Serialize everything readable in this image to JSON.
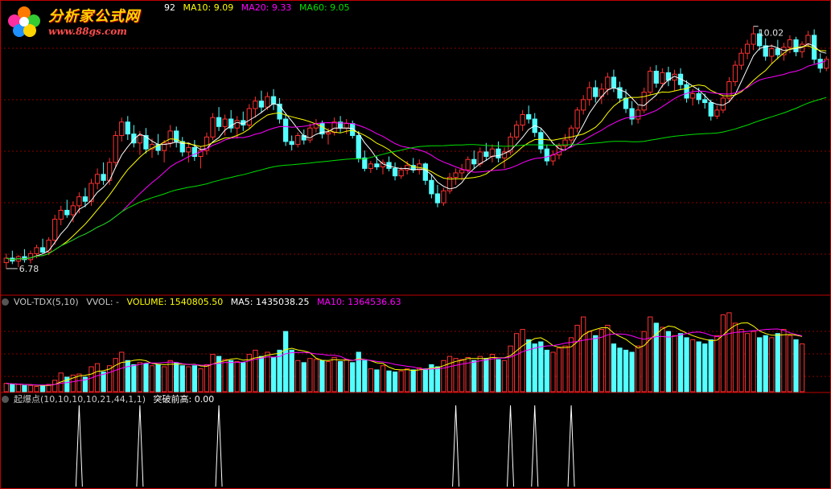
{
  "main": {
    "ma_prefix": "92",
    "ma10_label": "MA10: 9.09",
    "ma20_label": "MA20: 9.33",
    "ma60_label": "MA60: 9.05",
    "high_label": "10.02",
    "low_label": "6.78"
  },
  "volume": {
    "indicator": "VOL-TDX(5,10)",
    "vvol": "VVOL: -",
    "volume_label": "VOLUME: 1540805.50",
    "ma5_label": "MA5: 1435038.25",
    "ma10_label": "MA10: 1364536.63"
  },
  "signal": {
    "indicator": "起爆点(10,10,10,10,21,44,1,1)",
    "breakout_label": "突破前高: 0.00"
  },
  "logo": {
    "title": "分析家公式网",
    "url": "www.88gs.com"
  },
  "colors": {
    "up": "#ff3232",
    "down": "#54ffff",
    "ma5": "#ffffff",
    "ma10": "#ffff00",
    "ma20": "#ff00ff",
    "ma60": "#00e000",
    "grid": "#8b0000",
    "divider": "#c00000"
  },
  "chart_data": {
    "type": "candlestick",
    "price_range": [
      6.5,
      10.2
    ],
    "high": 10.02,
    "low": 6.78,
    "ohlc": [
      [
        6.86,
        6.98,
        6.78,
        6.92
      ],
      [
        6.92,
        7.02,
        6.84,
        6.88
      ],
      [
        6.88,
        6.96,
        6.8,
        6.94
      ],
      [
        6.94,
        7.04,
        6.86,
        6.9
      ],
      [
        6.9,
        7.02,
        6.85,
        6.98
      ],
      [
        6.98,
        7.1,
        6.92,
        7.06
      ],
      [
        7.06,
        7.18,
        6.98,
        7.0
      ],
      [
        7.0,
        7.2,
        6.96,
        7.16
      ],
      [
        7.16,
        7.5,
        7.1,
        7.44
      ],
      [
        7.44,
        7.62,
        7.36,
        7.56
      ],
      [
        7.56,
        7.7,
        7.46,
        7.5
      ],
      [
        7.5,
        7.68,
        7.4,
        7.62
      ],
      [
        7.62,
        7.8,
        7.52,
        7.74
      ],
      [
        7.74,
        7.86,
        7.6,
        7.68
      ],
      [
        7.68,
        7.98,
        7.62,
        7.92
      ],
      [
        7.92,
        8.12,
        7.84,
        8.04
      ],
      [
        8.04,
        8.2,
        7.9,
        7.96
      ],
      [
        7.96,
        8.26,
        7.9,
        8.2
      ],
      [
        8.2,
        8.62,
        8.14,
        8.56
      ],
      [
        8.56,
        8.8,
        8.48,
        8.74
      ],
      [
        8.74,
        8.82,
        8.5,
        8.58
      ],
      [
        8.58,
        8.7,
        8.4,
        8.46
      ],
      [
        8.46,
        8.62,
        8.3,
        8.56
      ],
      [
        8.56,
        8.66,
        8.32,
        8.38
      ],
      [
        8.38,
        8.52,
        8.26,
        8.44
      ],
      [
        8.44,
        8.58,
        8.3,
        8.36
      ],
      [
        8.36,
        8.5,
        8.2,
        8.46
      ],
      [
        8.46,
        8.7,
        8.4,
        8.62
      ],
      [
        8.62,
        8.68,
        8.4,
        8.48
      ],
      [
        8.48,
        8.54,
        8.28,
        8.34
      ],
      [
        8.34,
        8.46,
        8.2,
        8.4
      ],
      [
        8.4,
        8.5,
        8.22,
        8.28
      ],
      [
        8.28,
        8.42,
        8.12,
        8.36
      ],
      [
        8.36,
        8.6,
        8.3,
        8.54
      ],
      [
        8.54,
        8.86,
        8.5,
        8.8
      ],
      [
        8.8,
        8.94,
        8.62,
        8.68
      ],
      [
        8.68,
        8.84,
        8.56,
        8.78
      ],
      [
        8.78,
        8.9,
        8.6,
        8.66
      ],
      [
        8.66,
        8.82,
        8.52,
        8.76
      ],
      [
        8.76,
        8.88,
        8.62,
        8.7
      ],
      [
        8.7,
        8.98,
        8.66,
        8.92
      ],
      [
        8.92,
        9.08,
        8.8,
        9.02
      ],
      [
        9.02,
        9.16,
        8.86,
        8.94
      ],
      [
        8.94,
        9.14,
        8.9,
        9.08
      ],
      [
        9.08,
        9.18,
        8.9,
        8.98
      ],
      [
        8.98,
        9.06,
        8.72,
        8.78
      ],
      [
        8.78,
        8.86,
        8.42,
        8.48
      ],
      [
        8.48,
        8.56,
        8.36,
        8.44
      ],
      [
        8.44,
        8.6,
        8.4,
        8.56
      ],
      [
        8.56,
        8.64,
        8.44,
        8.5
      ],
      [
        8.5,
        8.72,
        8.46,
        8.66
      ],
      [
        8.66,
        8.78,
        8.6,
        8.72
      ],
      [
        8.72,
        8.76,
        8.52,
        8.58
      ],
      [
        8.58,
        8.66,
        8.44,
        8.6
      ],
      [
        8.6,
        8.8,
        8.56,
        8.74
      ],
      [
        8.74,
        8.82,
        8.6,
        8.66
      ],
      [
        8.66,
        8.78,
        8.58,
        8.72
      ],
      [
        8.72,
        8.76,
        8.52,
        8.56
      ],
      [
        8.56,
        8.62,
        8.2,
        8.26
      ],
      [
        8.26,
        8.36,
        8.08,
        8.12
      ],
      [
        8.12,
        8.22,
        8.06,
        8.18
      ],
      [
        8.18,
        8.28,
        8.1,
        8.14
      ],
      [
        8.14,
        8.24,
        8.04,
        8.2
      ],
      [
        8.2,
        8.28,
        8.08,
        8.12
      ],
      [
        8.12,
        8.2,
        7.96,
        8.02
      ],
      [
        8.02,
        8.14,
        7.98,
        8.1
      ],
      [
        8.1,
        8.22,
        8.04,
        8.16
      ],
      [
        8.16,
        8.26,
        8.06,
        8.1
      ],
      [
        8.1,
        8.24,
        8.04,
        8.18
      ],
      [
        8.18,
        8.2,
        7.9,
        7.96
      ],
      [
        7.96,
        8.04,
        7.72,
        7.78
      ],
      [
        7.78,
        7.9,
        7.6,
        7.66
      ],
      [
        7.66,
        7.86,
        7.62,
        7.82
      ],
      [
        7.82,
        8.06,
        7.78,
        8.0
      ],
      [
        8.0,
        8.12,
        7.9,
        8.06
      ],
      [
        8.06,
        8.18,
        7.96,
        8.1
      ],
      [
        8.1,
        8.28,
        8.06,
        8.24
      ],
      [
        8.24,
        8.36,
        8.12,
        8.18
      ],
      [
        8.18,
        8.4,
        8.14,
        8.34
      ],
      [
        8.34,
        8.46,
        8.22,
        8.28
      ],
      [
        8.28,
        8.44,
        8.2,
        8.38
      ],
      [
        8.38,
        8.48,
        8.2,
        8.26
      ],
      [
        8.26,
        8.4,
        8.12,
        8.34
      ],
      [
        8.34,
        8.6,
        8.3,
        8.54
      ],
      [
        8.54,
        8.76,
        8.5,
        8.7
      ],
      [
        8.7,
        8.9,
        8.62,
        8.84
      ],
      [
        8.84,
        8.96,
        8.72,
        8.78
      ],
      [
        8.78,
        8.86,
        8.54,
        8.6
      ],
      [
        8.6,
        8.66,
        8.32,
        8.38
      ],
      [
        8.38,
        8.44,
        8.16,
        8.22
      ],
      [
        8.22,
        8.36,
        8.16,
        8.3
      ],
      [
        8.3,
        8.46,
        8.24,
        8.42
      ],
      [
        8.42,
        8.58,
        8.36,
        8.5
      ],
      [
        8.5,
        8.7,
        8.44,
        8.66
      ],
      [
        8.66,
        8.94,
        8.6,
        8.9
      ],
      [
        8.9,
        9.1,
        8.84,
        9.04
      ],
      [
        9.04,
        9.28,
        8.96,
        9.2
      ],
      [
        9.2,
        9.3,
        9.0,
        9.08
      ],
      [
        9.08,
        9.26,
        8.98,
        9.18
      ],
      [
        9.18,
        9.4,
        9.1,
        9.34
      ],
      [
        9.34,
        9.44,
        9.14,
        9.2
      ],
      [
        9.2,
        9.28,
        9.0,
        9.06
      ],
      [
        9.06,
        9.18,
        8.86,
        8.92
      ],
      [
        8.92,
        9.02,
        8.7,
        8.78
      ],
      [
        8.78,
        8.96,
        8.72,
        8.9
      ],
      [
        8.9,
        9.2,
        8.86,
        9.14
      ],
      [
        9.14,
        9.48,
        9.1,
        9.42
      ],
      [
        9.42,
        9.5,
        9.2,
        9.26
      ],
      [
        9.26,
        9.46,
        9.2,
        9.4
      ],
      [
        9.4,
        9.48,
        9.22,
        9.3
      ],
      [
        9.3,
        9.44,
        9.16,
        9.38
      ],
      [
        9.38,
        9.46,
        9.18,
        9.24
      ],
      [
        9.24,
        9.3,
        9.0,
        9.06
      ],
      [
        9.06,
        9.18,
        8.96,
        9.12
      ],
      [
        9.12,
        9.2,
        8.98,
        9.04
      ],
      [
        9.04,
        9.12,
        8.92,
        9.0
      ],
      [
        9.0,
        9.04,
        8.76,
        8.82
      ],
      [
        8.82,
        8.96,
        8.78,
        8.9
      ],
      [
        8.9,
        9.1,
        8.86,
        9.06
      ],
      [
        9.06,
        9.34,
        9.0,
        9.28
      ],
      [
        9.28,
        9.56,
        9.22,
        9.5
      ],
      [
        9.5,
        9.72,
        9.44,
        9.66
      ],
      [
        9.66,
        9.84,
        9.58,
        9.78
      ],
      [
        9.78,
        10.02,
        9.7,
        9.92
      ],
      [
        9.92,
        9.98,
        9.7,
        9.76
      ],
      [
        9.76,
        9.86,
        9.56,
        9.62
      ],
      [
        9.62,
        9.78,
        9.52,
        9.72
      ],
      [
        9.72,
        9.84,
        9.58,
        9.64
      ],
      [
        9.64,
        9.8,
        9.56,
        9.74
      ],
      [
        9.74,
        9.9,
        9.66,
        9.84
      ],
      [
        9.84,
        9.88,
        9.62,
        9.68
      ],
      [
        9.68,
        9.82,
        9.6,
        9.78
      ],
      [
        9.78,
        9.96,
        9.74,
        9.9
      ],
      [
        9.9,
        9.98,
        9.52,
        9.58
      ],
      [
        9.58,
        9.66,
        9.4,
        9.46
      ],
      [
        9.46,
        9.62,
        9.42,
        9.58
      ]
    ],
    "volume": [
      8,
      7,
      7,
      6,
      6,
      5,
      6,
      7,
      11,
      18,
      14,
      16,
      17,
      14,
      24,
      27,
      19,
      25,
      32,
      38,
      30,
      26,
      28,
      27,
      25,
      26,
      24,
      30,
      28,
      25,
      24,
      25,
      22,
      26,
      36,
      34,
      31,
      30,
      29,
      28,
      36,
      40,
      34,
      38,
      33,
      40,
      58,
      40,
      30,
      28,
      32,
      31,
      30,
      29,
      33,
      29,
      31,
      28,
      38,
      30,
      22,
      21,
      25,
      20,
      19,
      20,
      22,
      21,
      23,
      22,
      26,
      24,
      30,
      34,
      32,
      31,
      33,
      30,
      34,
      32,
      36,
      31,
      30,
      44,
      56,
      60,
      50,
      46,
      48,
      40,
      38,
      42,
      44,
      52,
      64,
      72,
      58,
      54,
      60,
      64,
      46,
      42,
      40,
      38,
      44,
      58,
      72,
      66,
      62,
      58,
      54,
      56,
      52,
      50,
      48,
      46,
      50,
      54,
      74,
      76,
      66,
      60,
      56,
      58,
      52,
      54,
      52,
      56,
      60,
      54,
      50,
      46
    ],
    "signal_indices": [
      12,
      22,
      35,
      74,
      83,
      87,
      93
    ]
  }
}
